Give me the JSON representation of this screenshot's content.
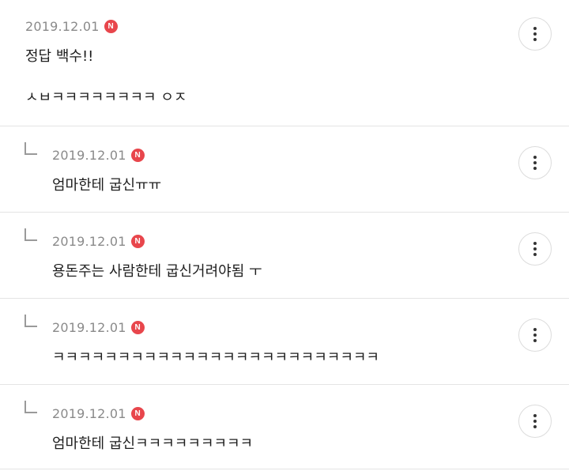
{
  "comments": [
    {
      "date": "2019.12.01",
      "badge": "N",
      "lines": [
        "정답 백수!!",
        "ㅅㅂㅋㅋㅋㅋㅋㅋㅋㅋ ㅇㅈ"
      ]
    },
    {
      "date": "2019.12.01",
      "badge": "N",
      "text": "엄마한테 굽신ㅠㅠ"
    },
    {
      "date": "2019.12.01",
      "badge": "N",
      "text": "용돈주는 사람한테 굽신거려야됨 ㅜ"
    },
    {
      "date": "2019.12.01",
      "badge": "N",
      "text": "ㅋㅋㅋㅋㅋㅋㅋㅋㅋㅋㅋㅋㅋㅋㅋㅋㅋㅋㅋㅋㅋㅋㅋㅋㅋ"
    },
    {
      "date": "2019.12.01",
      "badge": "N",
      "text": "엄마한테 굽신ㅋㅋㅋㅋㅋㅋㅋㅋㅋ"
    }
  ],
  "icons": {
    "more": "more-vertical-icon",
    "reply": "reply-arrow-icon",
    "new_badge_color": "#e8464c"
  }
}
